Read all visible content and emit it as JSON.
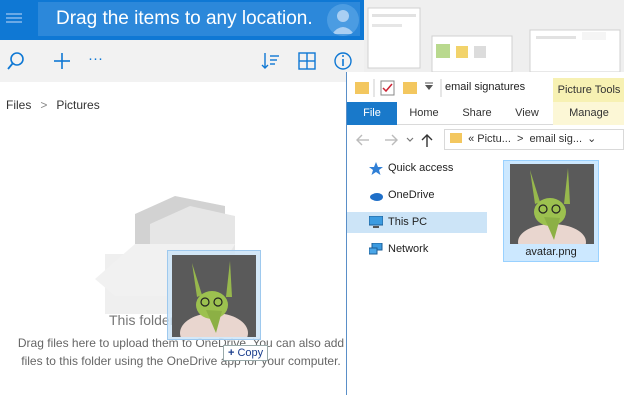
{
  "onedrive": {
    "drag_message": "Drag the items to any location.",
    "breadcrumb": {
      "root": "Files",
      "separator": ">",
      "current": "Pictures"
    },
    "empty_title": "This folder",
    "empty_description": "Drag files here to upload them to OneDrive. You can also add files to this folder using the OneDrive app for your computer.",
    "toolbar_icons": [
      "search-icon",
      "add-icon",
      "more-icon",
      "sort-icon",
      "view-icon",
      "info-icon"
    ],
    "accent_color": "#0f78d4",
    "more_glyph": "···"
  },
  "drag": {
    "copy_label": "Copy",
    "copy_glyph": "+"
  },
  "explorer": {
    "title": "email signatures",
    "contextual_tab": "Picture Tools",
    "ribbon_tabs": {
      "file": "File",
      "home": "Home",
      "share": "Share",
      "view": "View",
      "manage": "Manage"
    },
    "address": {
      "prefix": "«",
      "segment1": "Pictu...",
      "separator": ">",
      "segment2": "email sig...",
      "dropdown": "⌄"
    },
    "nav": {
      "quick_access": "Quick access",
      "onedrive": "OneDrive",
      "this_pc": "This PC",
      "network": "Network"
    },
    "file": {
      "name": "avatar.png"
    },
    "ribbon_accent": "#1979ca"
  }
}
